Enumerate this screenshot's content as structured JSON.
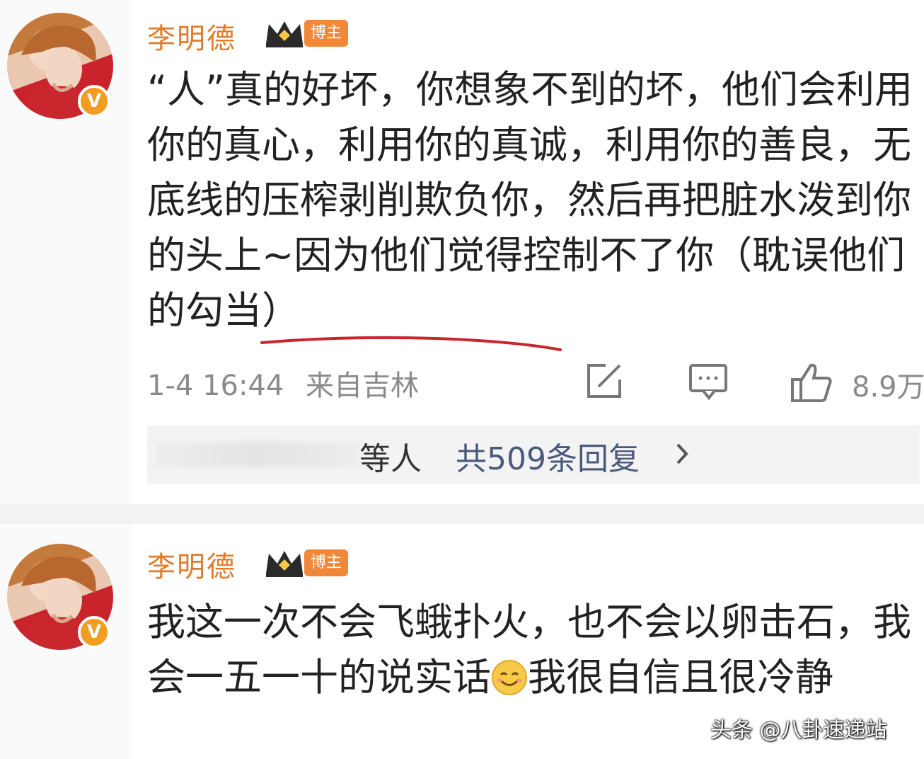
{
  "posts": [
    {
      "author": "李明德",
      "badge": "V",
      "tag": "博主",
      "text": "“人”真的好坏，你想象不到的坏，他们会利用你的真心，利用你的真诚，利用你的善良，无底线的压榨剥削欺负你，然后再把脏水泼到你的头上~因为他们觉得控制不了你（耽误他们的勾当）",
      "time": "1-4 16:44",
      "source": "来自吉林",
      "likes": "8.9万",
      "replies_who": "等人",
      "replies_count": "共509条回复"
    },
    {
      "author": "李明德",
      "badge": "V",
      "tag": "博主",
      "text_before_emoji": "我这一次不会飞蛾扑火，也不会以卵击石，我会一五一十的说实话",
      "text_after_emoji": "我很自信且很冷静"
    }
  ],
  "icons": [
    "share-icon",
    "comment-icon",
    "like-icon",
    "chevron-right-icon",
    "crown-icon",
    "smile-emoji"
  ],
  "colors": {
    "author": "#e07b2a",
    "badge": "#f29c20",
    "underline": "#c8252c",
    "meta": "#8a8a8a"
  },
  "watermark": "头条 @八卦速递站"
}
